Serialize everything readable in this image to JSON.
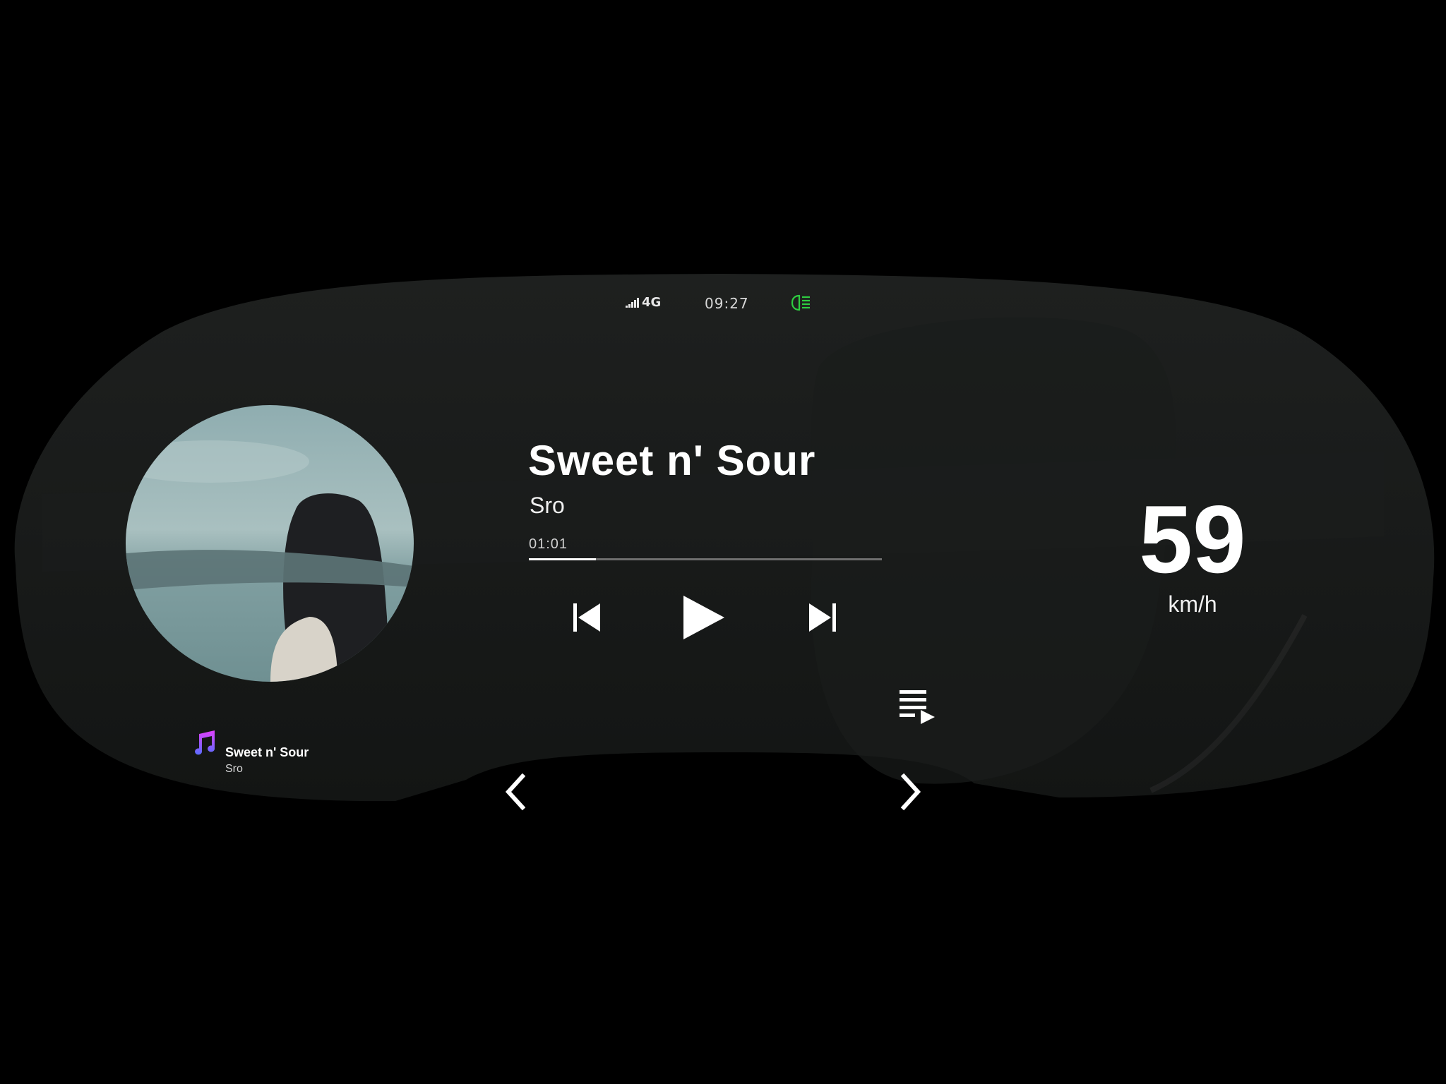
{
  "status_bar": {
    "network": "4G",
    "time": "09:27",
    "signal_icon": "signal-bars-icon",
    "headlight_icon": "low-beam-headlight-icon",
    "headlight_color": "#2ecc40"
  },
  "now_playing": {
    "title": "Sweet n' Sour",
    "artist": "Sro",
    "elapsed": "01:01",
    "progress_fraction": 0.19
  },
  "controls": {
    "previous_icon": "skip-previous-icon",
    "play_icon": "play-icon",
    "next_icon": "skip-next-icon",
    "queue_icon": "queue-music-icon"
  },
  "speedometer": {
    "value": "59",
    "unit": "km/h"
  },
  "mini_player": {
    "icon": "music-note-icon",
    "title": "Sweet n' Sour",
    "artist": "Sro"
  },
  "navigation": {
    "left_icon": "chevron-left-icon",
    "right_icon": "chevron-right-icon"
  },
  "colors": {
    "background": "#000000",
    "panel": "#181a19",
    "text": "#ffffff",
    "progress_fill": "#ffffff",
    "progress_track": "#6e6e6e"
  }
}
